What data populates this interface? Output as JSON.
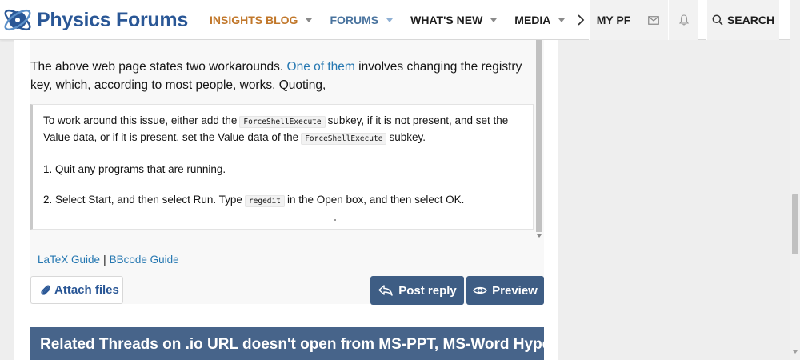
{
  "header": {
    "logo_text": "Physics Forums",
    "nav": [
      {
        "label": "INSIGHTS BLOG"
      },
      {
        "label": "FORUMS"
      },
      {
        "label": "WHAT'S NEW"
      },
      {
        "label": "MEDIA"
      }
    ],
    "my_pf": "MY PF",
    "search_label": "SEARCH",
    "icons": {
      "more": "chevron-right-icon",
      "mail": "envelope-icon",
      "bell": "bell-icon",
      "search": "search-icon"
    }
  },
  "editor": {
    "intro_before_link": "The above web page states two workarounds. ",
    "intro_link": "One of them",
    "intro_after_link": " involves changing the registry key, which, according to most people, works. Quoting,",
    "quote": {
      "line1_a": "To work around this issue, either add the",
      "code1": "ForceShellExecute",
      "line1_b": "subkey, if it is not present, and set the Value data, or if it is present, set the Value data of the",
      "code2": "ForceShellExecute",
      "line1_c": "subkey.",
      "step1": "1. Quit any programs that are running.",
      "step2_a": "2. Select Start, and then select Run. Type",
      "code3": "regedit",
      "step2_b": "in the Open box, and then select OK."
    }
  },
  "guides": {
    "latex": "LaTeX Guide",
    "separator": "|",
    "bbcode": "BBcode Guide"
  },
  "buttons": {
    "attach": "Attach files",
    "post_reply": "Post reply",
    "preview": "Preview"
  },
  "related": {
    "title": "Related Threads on .io URL doesn't open from MS-PPT, MS-Word Hyperlinks"
  },
  "colors": {
    "brand": "#2a5796",
    "insights": "#c1772a",
    "button": "#3e5d84",
    "link": "#2577b1"
  }
}
